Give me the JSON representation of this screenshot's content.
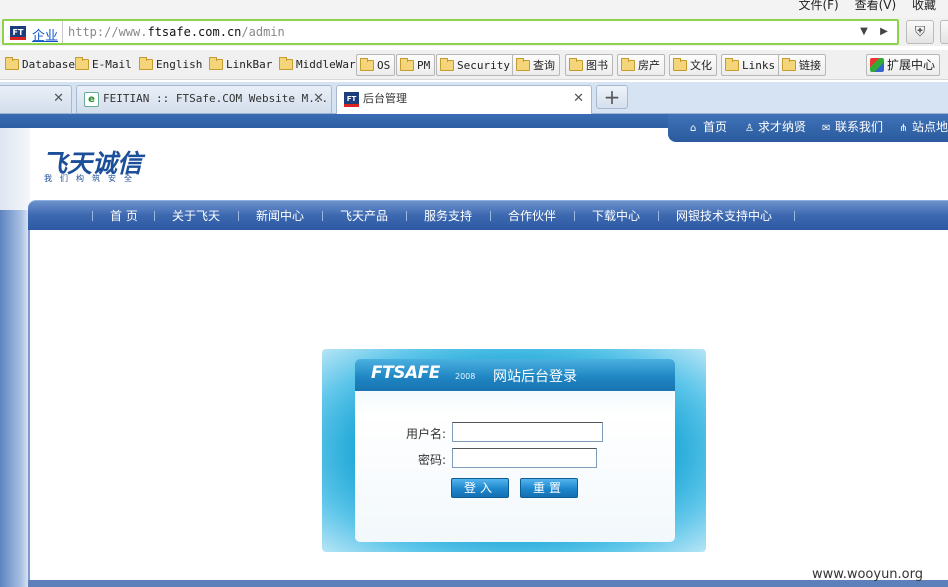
{
  "browser": {
    "top_menu": [
      "文件(F)",
      "查看(V)",
      "收藏"
    ],
    "address": {
      "site_label": "企业",
      "url_prefix": "http://www.",
      "url_host": "ftsafe.com.cn",
      "url_path": "/admin"
    },
    "bookmarks": [
      {
        "label": "Database",
        "boxed": false
      },
      {
        "label": "E-Mail",
        "boxed": false
      },
      {
        "label": "English",
        "boxed": false
      },
      {
        "label": "LinkBar",
        "boxed": false
      },
      {
        "label": "MiddleWar",
        "boxed": false
      },
      {
        "label": "OS",
        "boxed": true
      },
      {
        "label": "PM",
        "boxed": true
      },
      {
        "label": "Security",
        "boxed": true
      },
      {
        "label": "查询",
        "boxed": true
      },
      {
        "label": "图书",
        "boxed": true
      },
      {
        "label": "房产",
        "boxed": true
      },
      {
        "label": "文化",
        "boxed": true
      },
      {
        "label": "Links",
        "boxed": true
      },
      {
        "label": "链接",
        "boxed": true
      }
    ],
    "extension_center": "扩展中心",
    "tabs": [
      {
        "title": "",
        "active": false
      },
      {
        "title": "FEITIAN :: FTSafe.COM Website M...",
        "active": false
      },
      {
        "title": "后台管理",
        "active": true
      }
    ],
    "new_tab_symbol": "+"
  },
  "site": {
    "top_links": [
      {
        "icon": "home-icon",
        "label": "首页"
      },
      {
        "icon": "person-icon",
        "label": "求才纳贤"
      },
      {
        "icon": "mail-icon",
        "label": "联系我们"
      },
      {
        "icon": "sitemap-icon",
        "label": "站点地"
      }
    ],
    "logo_text": "飞天诚信",
    "logo_slogan": "我们构筑安全",
    "nav": [
      "首 页",
      "关于飞天",
      "新闻中心",
      "飞天产品",
      "服务支持",
      "合作伙伴",
      "下载中心",
      "网银技术支持中心"
    ]
  },
  "login": {
    "brand": "FTSAFE",
    "year": "2008",
    "title": "网站后台登录",
    "username_label": "用户名:",
    "username_value": "",
    "password_label": "密码:",
    "password_value": "",
    "submit_label": "登入",
    "reset_label": "重置"
  },
  "watermark": "www.wooyun.org",
  "colors": {
    "nav_blue": "#2c5aa2",
    "address_border": "#8bd34a",
    "login_header": "#1e84c2"
  }
}
